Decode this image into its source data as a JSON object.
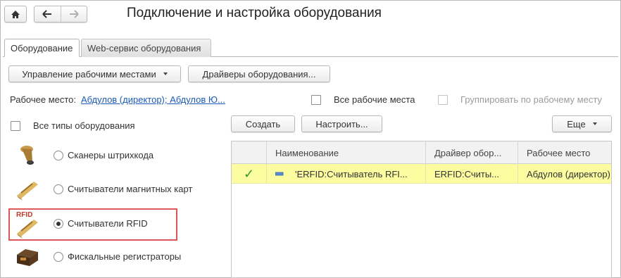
{
  "window": {
    "title": "Подключение и настройка оборудования"
  },
  "nav": {
    "home_icon": "home-icon",
    "back_icon": "arrow-left-icon",
    "forward_icon": "arrow-right-icon"
  },
  "tabs": [
    {
      "label": "Оборудование",
      "active": true
    },
    {
      "label": "Web-сервис оборудования",
      "active": false
    }
  ],
  "toolbar": {
    "workplaces_label": "Управление рабочими местами",
    "drivers_label": "Драйверы оборудования..."
  },
  "workplace": {
    "label": "Рабочее место:",
    "value": "Абдулов (директор); Абдулов Ю...",
    "all_workplaces_label": "Все рабочие места",
    "all_workplaces_checked": false,
    "group_label": "Группировать по рабочему месту",
    "group_checked": false
  },
  "equipment_types": {
    "all_types_label": "Все типы оборудования",
    "all_types_checked": false,
    "items": [
      {
        "label": "Сканеры штрихкода",
        "icon": "barcode-scanner-icon",
        "selected": false
      },
      {
        "label": "Считыватели магнитных карт",
        "icon": "magnetic-card-reader-icon",
        "selected": false
      },
      {
        "label": "Считыватели RFID",
        "icon": "rfid-reader-icon",
        "icon_text": "RFID",
        "selected": true
      },
      {
        "label": "Фискальные регистраторы",
        "icon": "fiscal-printer-icon",
        "selected": false
      }
    ]
  },
  "list_toolbar": {
    "create_label": "Создать",
    "configure_label": "Настроить...",
    "more_label": "Еще"
  },
  "table": {
    "columns": [
      "",
      "Наименование",
      "Драйвер обор...",
      "Рабочее место"
    ],
    "rows": [
      {
        "check": "✓",
        "name": "'ERFID:Считыватель RFI...",
        "driver": "ERFID:Считы...",
        "workplace": "Абдулов (директор); А"
      }
    ]
  },
  "colors": {
    "accent_link": "#1a5bb5",
    "selected_row": "#fcfca0",
    "check_green": "#2e9c2e",
    "highlight_border": "#e0575a"
  }
}
